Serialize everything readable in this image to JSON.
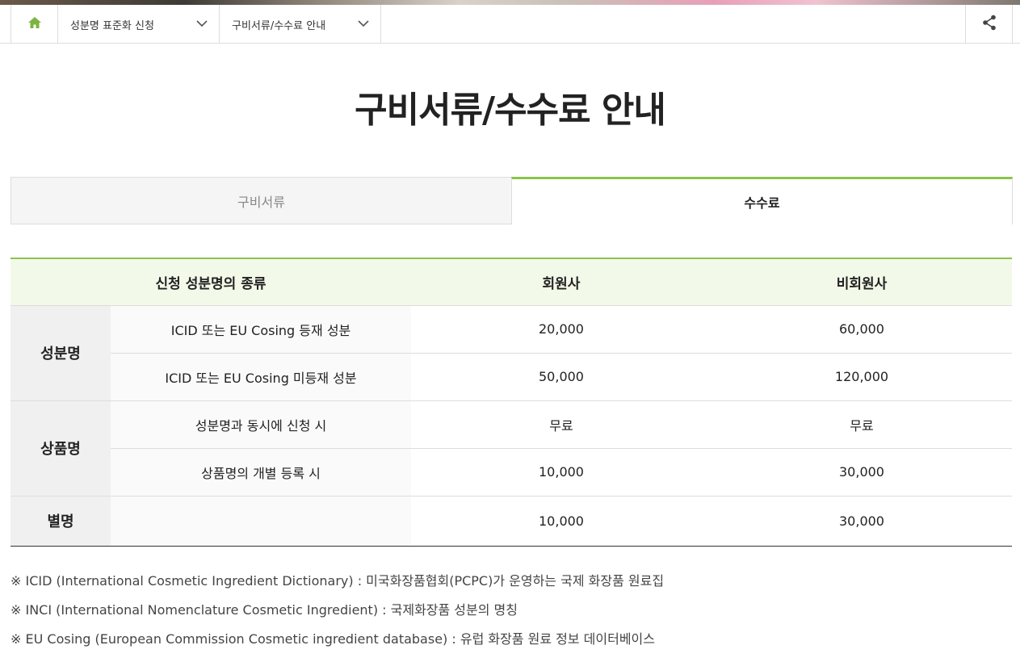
{
  "breadcrumb": {
    "select1": "성분명 표준화 신청",
    "select2": "구비서류/수수료 안내"
  },
  "page": {
    "title": "구비서류/수수료 안내"
  },
  "tabs": [
    {
      "label": "구비서류",
      "active": false
    },
    {
      "label": "수수료",
      "active": true
    }
  ],
  "table": {
    "headers": [
      "신청 성분명의 종류",
      "회원사",
      "비회원사"
    ],
    "groups": [
      {
        "label": "성분명",
        "rows": [
          {
            "type": "ICID 또는 EU Cosing 등재 성분",
            "member": "20,000",
            "nonmember": "60,000"
          },
          {
            "type": "ICID 또는 EU Cosing 미등재 성분",
            "member": "50,000",
            "nonmember": "120,000"
          }
        ]
      },
      {
        "label": "상품명",
        "rows": [
          {
            "type": "성분명과 동시에 신청 시",
            "member": "무료",
            "nonmember": "무료"
          },
          {
            "type": "상품명의 개별 등록 시",
            "member": "10,000",
            "nonmember": "30,000"
          }
        ]
      },
      {
        "label": "별명",
        "rows": [
          {
            "type": "",
            "member": "10,000",
            "nonmember": "30,000"
          }
        ]
      }
    ]
  },
  "notes": [
    "※ ICID (International Cosmetic Ingredient Dictionary) : 미국화장품협회(PCPC)가 운영하는 국제 화장품 원료집",
    "※ INCI (International Nomenclature Cosmetic Ingredient) : 국제화장품 성분의 명칭",
    "※ EU Cosing (European Commission Cosmetic ingredient database) : 유럽 화장품 원료 정보 데이터베이스"
  ],
  "colors": {
    "accent": "#8bc34a",
    "header_bg": "#f3f9e9",
    "home_icon": "#7cb342"
  },
  "icons": [
    "home-icon",
    "chevron-down-icon",
    "share-icon"
  ]
}
